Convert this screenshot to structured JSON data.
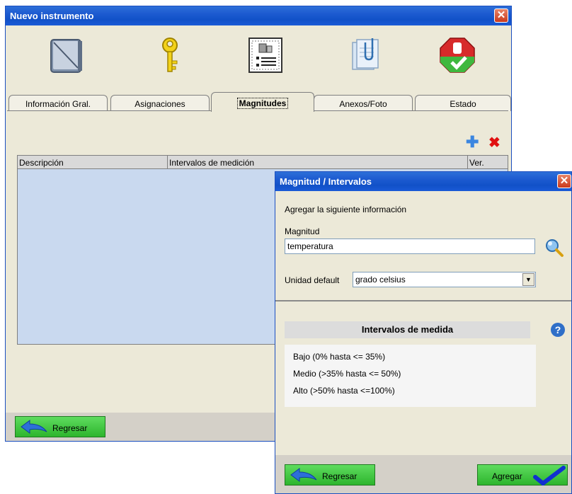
{
  "main_window": {
    "title": "Nuevo instrumento",
    "close_glyph": "✕",
    "toolbar_icons": [
      "notebook-icon",
      "key-icon",
      "weights-list-icon",
      "attachment-icon",
      "status-stop-check-icon"
    ],
    "tabs": [
      {
        "label": "Información Gral.",
        "active": false
      },
      {
        "label": "Asignaciones",
        "active": false
      },
      {
        "label": "Magnitudes",
        "active": true
      },
      {
        "label": "Anexos/Foto",
        "active": false
      },
      {
        "label": "Estado",
        "active": false
      }
    ],
    "grid": {
      "columns": [
        "Descripción",
        "Intervalos de medición",
        "Ver."
      ],
      "rows": []
    },
    "add_glyph": "✚",
    "delete_glyph": "✖",
    "back_label": "Regresar"
  },
  "dialog": {
    "title": "Magnitud / Intervalos",
    "close_glyph": "✕",
    "instruction": "Agregar la siguiente información",
    "magnitud_label": "Magnitud",
    "magnitud_value": "temperatura",
    "unidad_label": "Unidad default",
    "unidad_value": "grado celsius",
    "dropdown_glyph": "▼",
    "intervals_title": "Intervalos de medida",
    "help_glyph": "?",
    "intervals": [
      "Bajo (0% hasta <= 35%)",
      "Medio (>35% hasta <= 50%)",
      "Alto (>50% hasta <=100%)"
    ],
    "back_label": "Regresar",
    "add_label": "Agregar"
  },
  "colors": {
    "titlebar": "#1151c8",
    "grid_body": "#c9d9ef",
    "button_green": "#2db52d",
    "delete_red": "#e01010",
    "add_blue": "#3b86e0"
  }
}
